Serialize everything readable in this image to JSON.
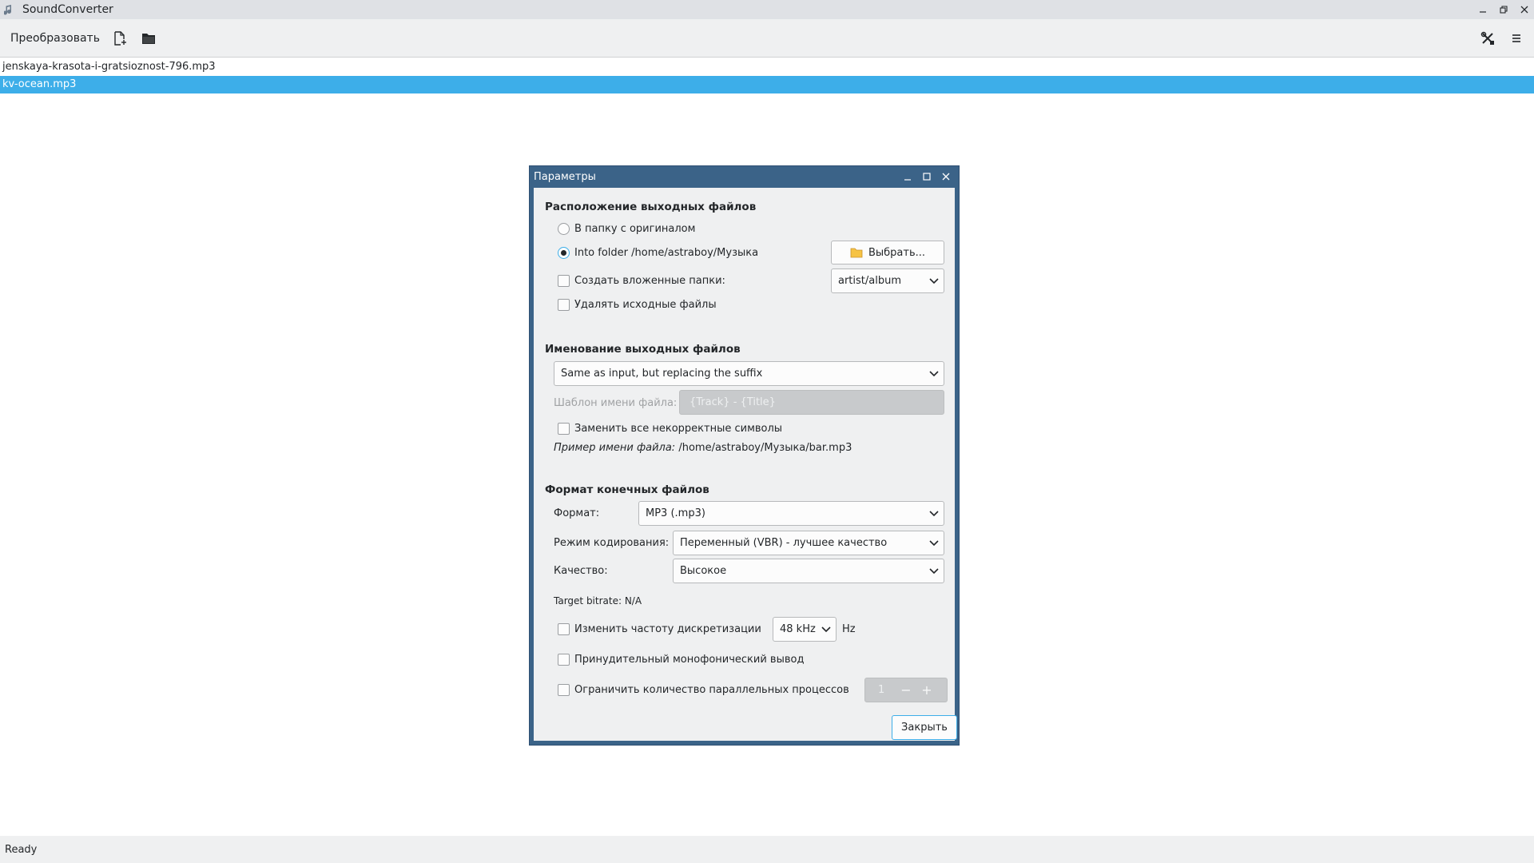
{
  "window": {
    "title": "SoundConverter"
  },
  "toolbar": {
    "convert_label": "Преобразовать",
    "icons": [
      "add-file-icon",
      "add-folder-icon",
      "preferences-icon",
      "menu-icon"
    ]
  },
  "files": [
    {
      "name": "jenskaya-krasota-i-gratsioznost-796.mp3",
      "selected": false
    },
    {
      "name": "kv-ocean.mp3",
      "selected": true
    }
  ],
  "status": {
    "text": "Ready"
  },
  "dialog": {
    "title": "Параметры",
    "output_location": {
      "heading": "Расположение выходных файлов",
      "radio_original": "В папку с оригиналом",
      "radio_folder": "Into folder /home/astraboy/Музыка",
      "radio_selected": "folder",
      "choose_button": "Выбрать...",
      "create_subfolders_label": "Создать вложенные папки:",
      "create_subfolders_checked": false,
      "subfolder_pattern": "artist/album",
      "delete_originals_label": "Удалять исходные файлы",
      "delete_originals_checked": false
    },
    "naming": {
      "heading": "Именование выходных файлов",
      "mode": "Same as input, but replacing the suffix",
      "template_label": "Шаблон имени файла:",
      "template_value": "{Track} - {Title}",
      "replace_invalid_label": "Заменить все некорректные символы",
      "replace_invalid_checked": false,
      "example_label": "Пример имени файла:",
      "example_value": "/home/astraboy/Музыка/bar.mp3"
    },
    "format": {
      "heading": "Формат конечных файлов",
      "format_label": "Формат:",
      "format_value": "MP3 (.mp3)",
      "mode_label": "Режим кодирования:",
      "mode_value": "Переменный (VBR) - лучшее качество",
      "quality_label": "Качество:",
      "quality_value": "Высокое",
      "target_bitrate": "Target bitrate: N/A",
      "resample_label": "Изменить частоту дискретизации",
      "resample_checked": false,
      "resample_value": "48 kHz",
      "resample_unit": "Hz",
      "mono_label": "Принудительный монофонический вывод",
      "mono_checked": false,
      "limit_jobs_label": "Ограничить количество параллельных процессов",
      "limit_jobs_checked": false,
      "jobs_value": "1",
      "jobs_minus": "−",
      "jobs_plus": "+"
    },
    "close_button": "Закрыть"
  },
  "colors": {
    "selection": "#3daee9",
    "dialog_frame": "#3b6388",
    "window_bg": "#eff0f1"
  }
}
